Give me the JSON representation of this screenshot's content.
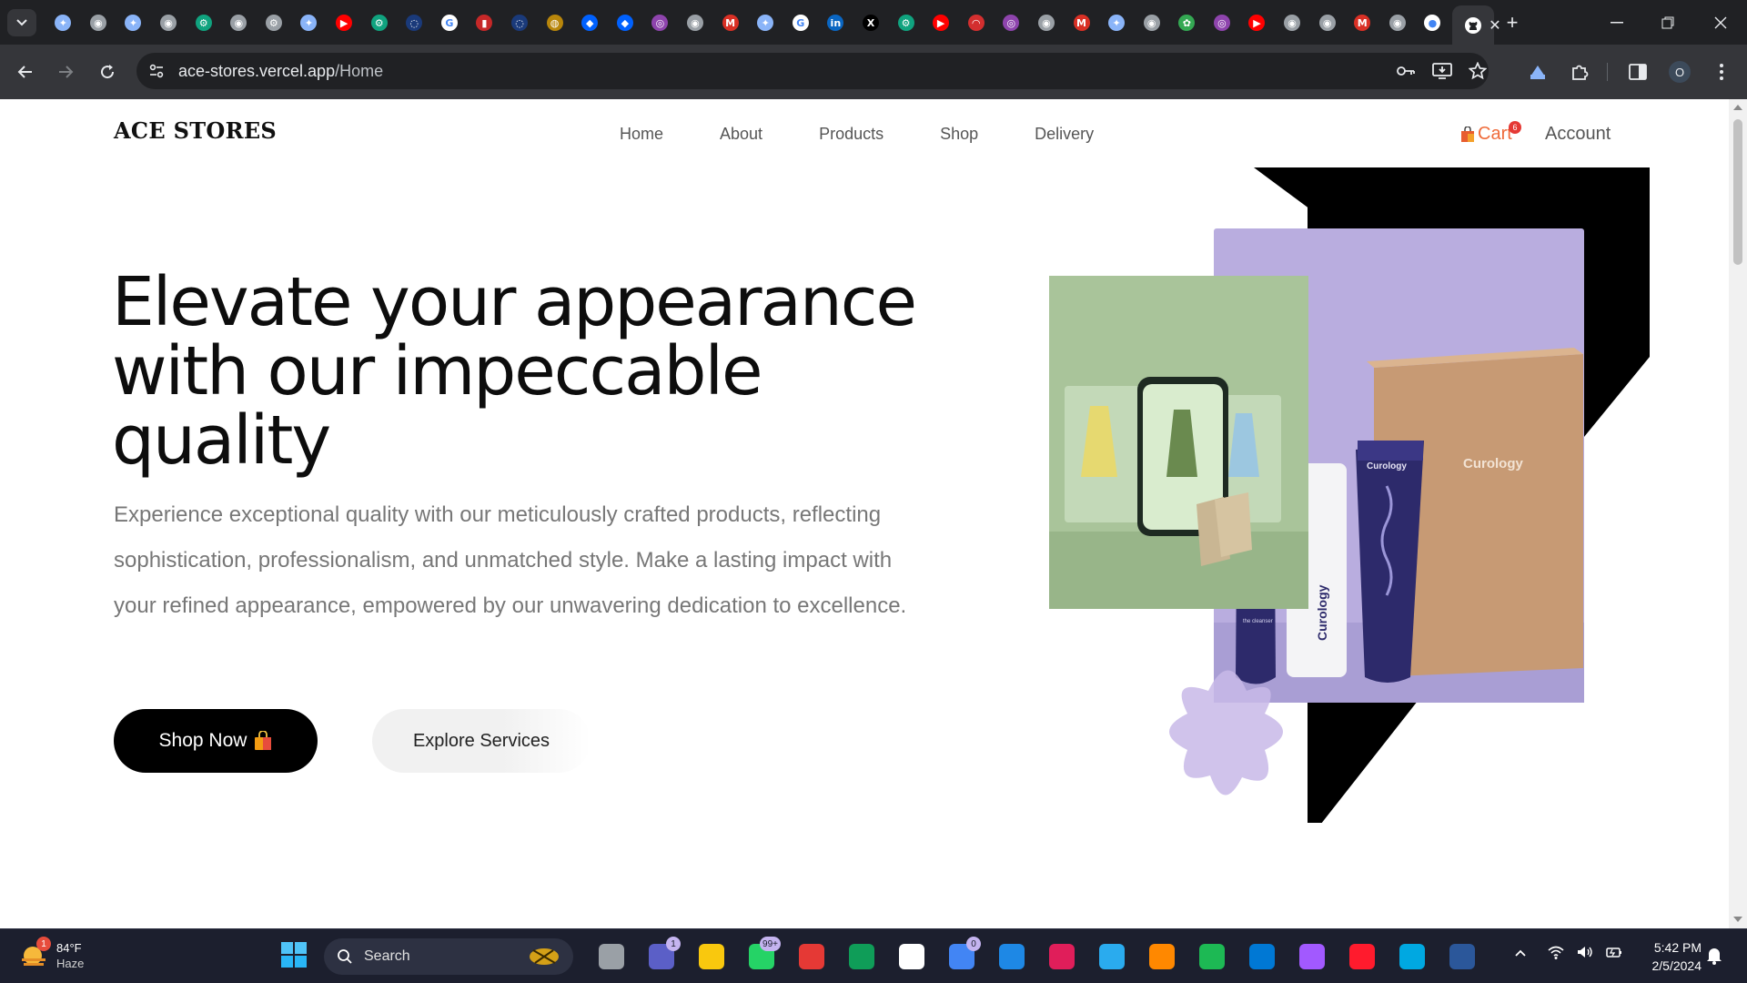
{
  "browser": {
    "url_host": "ace-stores.vercel.app",
    "url_path": "/Home",
    "tab_favicons": [
      "gemini-icon",
      "chrome-icon",
      "gemini-icon",
      "chrome-icon",
      "chatgpt-icon",
      "chrome-icon",
      "settings-icon",
      "gemini-icon",
      "youtube-icon",
      "chatgpt-icon",
      "globe-icon",
      "google-icon",
      "chart-icon",
      "globe-icon",
      "emblem-icon",
      "dropbox-icon",
      "dropbox-icon",
      "app-icon",
      "chrome-icon",
      "gmail-icon",
      "gemini-icon",
      "google-icon",
      "linkedin-icon",
      "x-icon",
      "chatgpt-icon",
      "youtube-icon",
      "speed-icon",
      "app-icon",
      "chrome-icon",
      "gmail-icon",
      "gemini-icon",
      "chrome-icon",
      "photos-icon",
      "app-icon",
      "youtube-icon",
      "chrome-icon",
      "chrome-icon",
      "gmail-icon",
      "chrome-icon",
      "github-icon"
    ],
    "profile_initial": "O"
  },
  "site": {
    "brand": "ACE STORES",
    "nav": [
      "Home",
      "About",
      "Products",
      "Shop",
      "Delivery"
    ],
    "cart_label": "Cart",
    "cart_count": "6",
    "account_label": "Account"
  },
  "hero": {
    "title": "Elevate your appearance with our impeccable quality",
    "description": "Experience exceptional quality with our meticulously crafted products, reflecting sophistication, professionalism, and unmatched style. Make a lasting impact with your refined appearance, empowered by our unwavering dedication to excellence.",
    "primary_button": "Shop Now",
    "secondary_button": "Explore Services",
    "product_brand": "Curology",
    "tube_label": "the cleanser"
  },
  "taskbar": {
    "weather_temp": "84°F",
    "weather_condition": "Haze",
    "weather_badge": "1",
    "search_placeholder": "Search",
    "teams_badge": "1",
    "whatsapp_badge": "99+",
    "chrome_badge": "0",
    "time": "5:42 PM",
    "date": "2/5/2024"
  },
  "colors": {
    "accent_cart": "#ef6b3a",
    "hero_purple": "#b9addf",
    "hero_green": "#a9c49a",
    "taskbar_bg": "#1c1f2e"
  }
}
